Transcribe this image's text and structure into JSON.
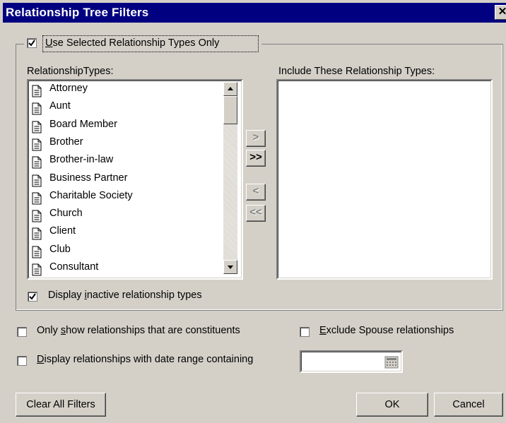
{
  "window": {
    "title": "Relationship Tree Filters",
    "close_glyph": "✕"
  },
  "group": {
    "use_selected": {
      "checked": true,
      "label_prefix": "",
      "label_u": "U",
      "label_rest": "se Selected Relationship Types Only"
    },
    "types_label": "RelationshipTypes:",
    "include_label": "Include These Relationship Types:",
    "types": [
      "Attorney",
      "Aunt",
      "Board Member",
      "Brother",
      "Brother-in-law",
      "Business Partner",
      "Charitable Society",
      "Church",
      "Client",
      "Club",
      "Consultant"
    ],
    "move_buttons": {
      "add_one": ">",
      "add_all": ">>",
      "remove_one": "<",
      "remove_all": "<<"
    },
    "display_inactive": {
      "checked": true,
      "label_prefix": "Display ",
      "label_u": "i",
      "label_rest": "nactive relationship types"
    }
  },
  "options": {
    "only_constituents": {
      "checked": false,
      "label_prefix": "Only ",
      "label_u": "s",
      "label_rest": "how relationships that are constituents"
    },
    "exclude_spouse": {
      "checked": false,
      "label_prefix": "",
      "label_u": "E",
      "label_rest": "xclude Spouse relationships"
    },
    "date_range": {
      "checked": false,
      "label_prefix": "",
      "label_u": "D",
      "label_rest": "isplay relationships with date range containing",
      "value": ""
    }
  },
  "buttons": {
    "clear": "Clear All Filters",
    "ok": "OK",
    "cancel": "Cancel"
  }
}
